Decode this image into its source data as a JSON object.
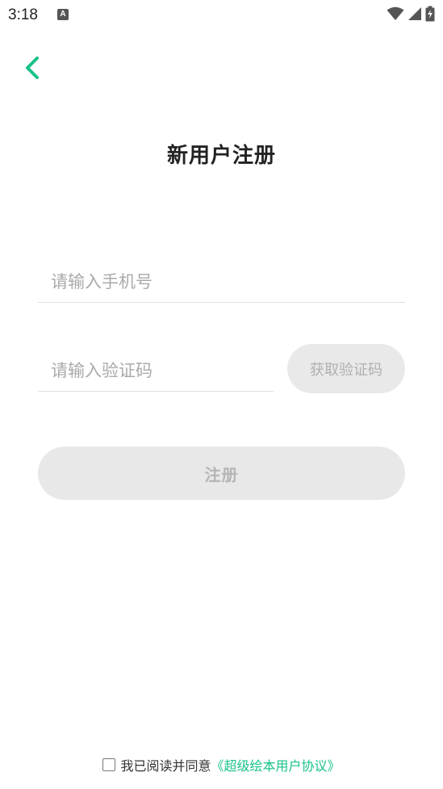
{
  "status_bar": {
    "time": "3:18",
    "notification_icon_label": "A",
    "icons": [
      "wifi-icon",
      "signal-icon",
      "battery-charging-icon"
    ]
  },
  "header": {
    "back_icon": "chevron-left-icon",
    "title": "新用户注册"
  },
  "form": {
    "phone_placeholder": "请输入手机号",
    "phone_value": "",
    "code_placeholder": "请输入验证码",
    "code_value": "",
    "get_code_label": "获取验证码",
    "register_label": "注册"
  },
  "agreement": {
    "checked": false,
    "text": "我已阅读并同意",
    "link_text": "《超级绘本用户协议》"
  },
  "colors": {
    "accent": "#18c28a",
    "disabled_bg": "#e8e8e8",
    "disabled_text": "#b5b5b5"
  }
}
